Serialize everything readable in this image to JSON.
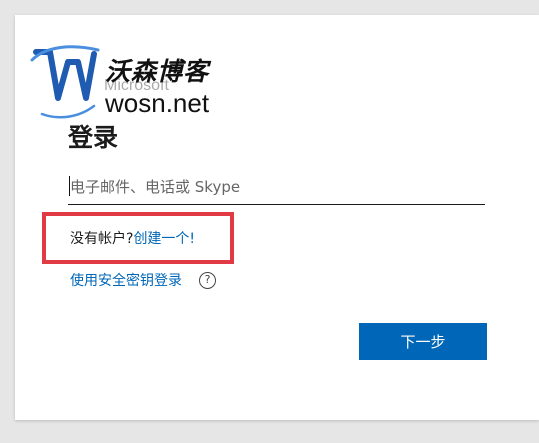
{
  "watermark": {
    "brand_cn": "沃森博客",
    "brand_en": "wosn.net",
    "logo_icon": "wosn-w-logo",
    "colors": {
      "blue": "#1f5bb0",
      "light_blue": "#4a8ee0"
    }
  },
  "header": {
    "brand": "Microsoft",
    "title": "登录"
  },
  "form": {
    "identity_placeholder": "电子邮件、电话或 Skype",
    "identity_value": ""
  },
  "links": {
    "no_account_text": "没有帐户?",
    "create_account": "创建一个!",
    "security_key_signin": "使用安全密钥登录",
    "help_icon": "?"
  },
  "buttons": {
    "next": "下一步"
  },
  "colors": {
    "accent": "#0067b8",
    "highlight": "#e03a45",
    "background": "#e6e6e6",
    "card": "#ffffff"
  }
}
